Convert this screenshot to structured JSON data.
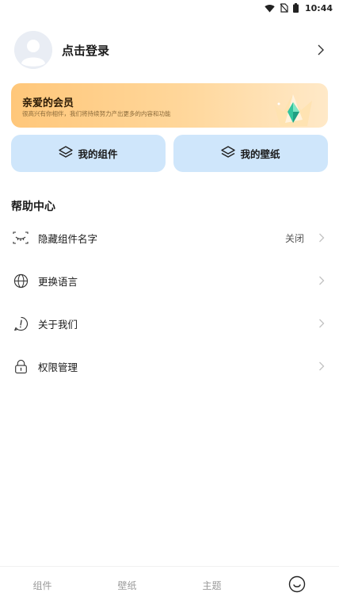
{
  "status_bar": {
    "time": "10:44"
  },
  "profile": {
    "login_label": "点击登录"
  },
  "vip": {
    "title": "亲爱的会员",
    "subtitle": "很高兴有你相伴，我们将持续努力产出更多的内容和功能"
  },
  "actions": {
    "widgets_label": "我的组件",
    "wallpapers_label": "我的壁纸"
  },
  "help": {
    "title": "帮助中心",
    "items": [
      {
        "label": "隐藏组件名字",
        "value": "关闭",
        "icon": "eye-closed-icon"
      },
      {
        "label": "更换语言",
        "value": "",
        "icon": "globe-icon"
      },
      {
        "label": "关于我们",
        "value": "",
        "icon": "info-icon"
      },
      {
        "label": "权限管理",
        "value": "",
        "icon": "lock-icon"
      }
    ]
  },
  "nav": {
    "items": [
      {
        "label": "组件"
      },
      {
        "label": "壁纸"
      },
      {
        "label": "主题"
      },
      {
        "label": "",
        "icon": "smile-icon"
      }
    ]
  },
  "colors": {
    "action_button_bg": "#cfe6fb",
    "vip_gradient_start": "#ffc77a",
    "vip_gradient_end": "#ffe9c8",
    "nav_text": "#9a9a9a"
  }
}
